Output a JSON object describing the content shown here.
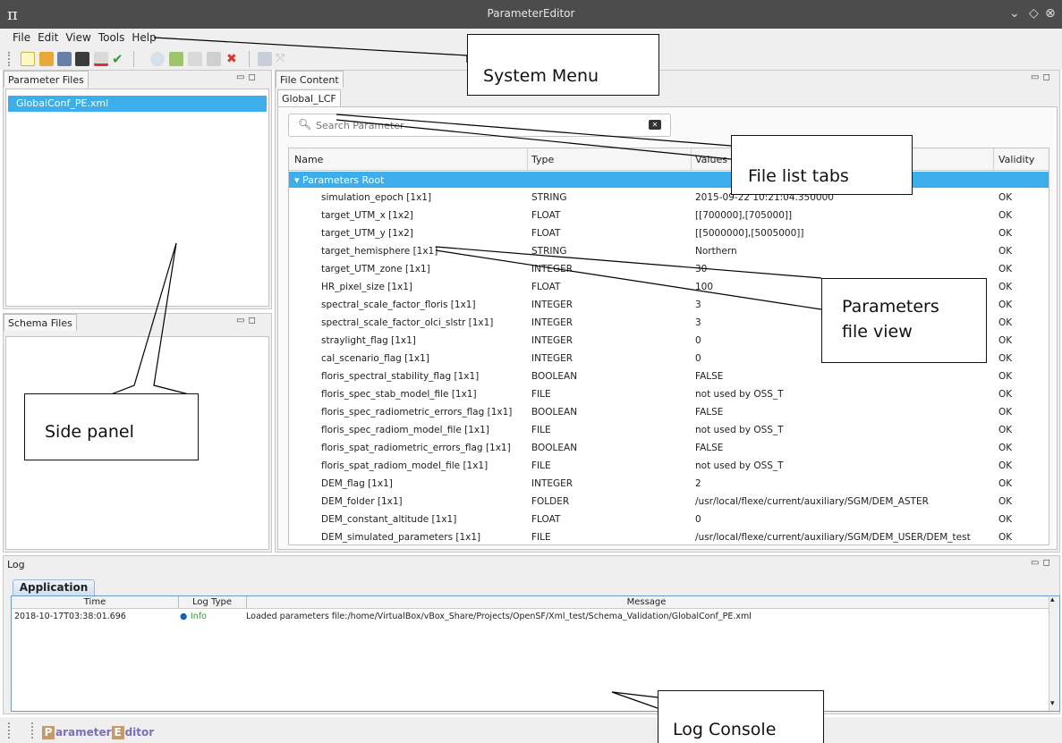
{
  "window": {
    "title": "ParameterEditor"
  },
  "menu": [
    "File",
    "Edit",
    "View",
    "Tools",
    "Help"
  ],
  "side": {
    "param_files_tab": "Parameter Files",
    "files": [
      "GlobalConf_PE.xml"
    ],
    "schema_files_tab": "Schema Files"
  },
  "content": {
    "tab": "File Content",
    "file_tab": "Global_LCF",
    "search_placeholder": "Search Parameter",
    "columns": [
      "Name",
      "Type",
      "Values",
      "Validity"
    ],
    "root": "Parameters Root",
    "rows": [
      [
        "simulation_epoch [1x1]",
        "STRING",
        "2015-09-22 10:21:04.350000",
        "OK"
      ],
      [
        "target_UTM_x [1x2]",
        "FLOAT",
        "[[700000],[705000]]",
        "OK"
      ],
      [
        "target_UTM_y [1x2]",
        "FLOAT",
        "[[5000000],[5005000]]",
        "OK"
      ],
      [
        "target_hemisphere [1x1]",
        "STRING",
        "Northern",
        "OK"
      ],
      [
        "target_UTM_zone [1x1]",
        "INTEGER",
        "30",
        "OK"
      ],
      [
        "HR_pixel_size [1x1]",
        "FLOAT",
        "100",
        "OK"
      ],
      [
        "spectral_scale_factor_floris [1x1]",
        "INTEGER",
        "3",
        "OK"
      ],
      [
        "spectral_scale_factor_olci_slstr [1x1]",
        "INTEGER",
        "3",
        "OK"
      ],
      [
        "straylight_flag [1x1]",
        "INTEGER",
        "0",
        "OK"
      ],
      [
        "cal_scenario_flag [1x1]",
        "INTEGER",
        "0",
        "OK"
      ],
      [
        "floris_spectral_stability_flag [1x1]",
        "BOOLEAN",
        "FALSE",
        "OK"
      ],
      [
        "floris_spec_stab_model_file [1x1]",
        "FILE",
        "not used by OSS_T",
        "OK"
      ],
      [
        "floris_spec_radiometric_errors_flag [1x1]",
        "BOOLEAN",
        "FALSE",
        "OK"
      ],
      [
        "floris_spec_radiom_model_file [1x1]",
        "FILE",
        "not used by OSS_T",
        "OK"
      ],
      [
        "floris_spat_radiometric_errors_flag [1x1]",
        "BOOLEAN",
        "FALSE",
        "OK"
      ],
      [
        "floris_spat_radiom_model_file [1x1]",
        "FILE",
        "not used by OSS_T",
        "OK"
      ],
      [
        "DEM_flag [1x1]",
        "INTEGER",
        "2",
        "OK"
      ],
      [
        "DEM_folder [1x1]",
        "FOLDER",
        "/usr/local/flexe/current/auxiliary/SGM/DEM_ASTER",
        "OK"
      ],
      [
        "DEM_constant_altitude [1x1]",
        "FLOAT",
        "0",
        "OK"
      ],
      [
        "DEM_simulated_parameters [1x1]",
        "FILE",
        "/usr/local/flexe/current/auxiliary/SGM/DEM_USER/DEM_test",
        "OK"
      ]
    ]
  },
  "log": {
    "panel_tab": "Log",
    "app_tab": "Application",
    "columns": [
      "Time",
      "Log Type",
      "Message"
    ],
    "entries": [
      {
        "time": "2018-10-17T03:38:01.696",
        "type": "Info",
        "message": "Loaded parameters file:/home/VirtualBox/vBox_Share/Projects/OpenSF/Xml_test/Schema_Validation/GlobalConf_PE.xml"
      }
    ]
  },
  "status": {
    "brand_first": "P",
    "brand_mid": "arameter",
    "brand_second": "E",
    "brand_end": "ditor"
  },
  "annotations": {
    "system_menu": "System Menu",
    "file_list_tabs": "File list tabs",
    "params_view_1": "Parameters",
    "params_view_2": "file view",
    "side_panel": "Side panel",
    "log_console": "Log Console"
  },
  "colors": {
    "selection": "#3daee9",
    "titlebar": "#4c4c4c",
    "panel": "#efefef"
  }
}
